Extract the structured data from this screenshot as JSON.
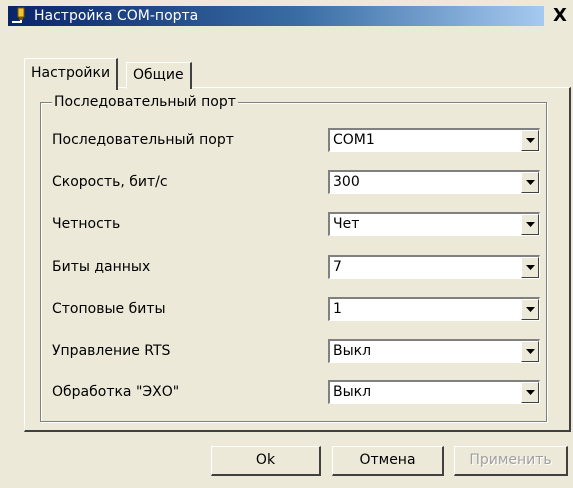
{
  "window": {
    "title": "Настройка COM-порта",
    "close_label": "X"
  },
  "tabs": [
    {
      "label": "Настройки",
      "active": true
    },
    {
      "label": "Общие",
      "active": false
    }
  ],
  "group": {
    "legend": "Последовательный порт",
    "rows": [
      {
        "label": "Последовательный порт",
        "value": "COM1"
      },
      {
        "label": "Скорость, бит/с",
        "value": "300"
      },
      {
        "label": "Четность",
        "value": "Чет"
      },
      {
        "label": "Биты данных",
        "value": "7"
      },
      {
        "label": "Стоповые биты",
        "value": "1"
      },
      {
        "label": "Управление RTS",
        "value": "Выкл"
      },
      {
        "label": "Обработка \"ЭХО\"",
        "value": "Выкл"
      }
    ]
  },
  "buttons": {
    "ok": "Ok",
    "cancel": "Отмена",
    "apply": "Применить"
  },
  "icons": {
    "app": "com-port-plug-icon",
    "dropdown": "chevron-down-icon"
  }
}
